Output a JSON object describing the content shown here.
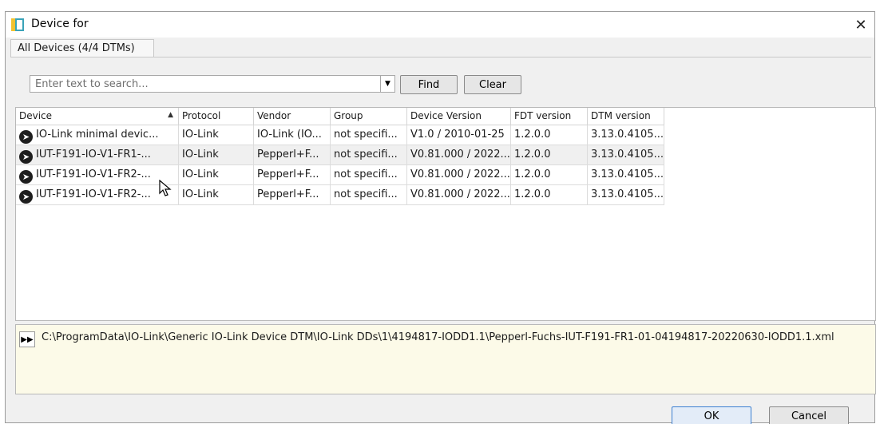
{
  "window": {
    "title": "Device for",
    "close_glyph": "✕"
  },
  "tabs": [
    {
      "label": "All Devices (4/4 DTMs)"
    }
  ],
  "search": {
    "placeholder": "Enter text to search...",
    "value": "",
    "dropdown_glyph": "▼",
    "find_label": "Find",
    "clear_label": "Clear"
  },
  "table": {
    "columns": [
      "Device",
      "Protocol",
      "Vendor",
      "Group",
      "Device Version",
      "FDT version",
      "DTM version"
    ],
    "sort_glyph": "▲",
    "rows": [
      {
        "device": "IO-Link minimal devic...",
        "protocol": "IO-Link",
        "vendor": "IO-Link (IO...",
        "group": "not specifi...",
        "device_version": "V1.0 / 2010-01-25",
        "fdt_version": "1.2.0.0",
        "dtm_version": "3.13.0.4105..."
      },
      {
        "device": "IUT-F191-IO-V1-FR1-...",
        "protocol": "IO-Link",
        "vendor": "Pepperl+F...",
        "group": "not specifi...",
        "device_version": "V0.81.000 / 2022...",
        "fdt_version": "1.2.0.0",
        "dtm_version": "3.13.0.4105..."
      },
      {
        "device": "IUT-F191-IO-V1-FR2-...",
        "protocol": "IO-Link",
        "vendor": "Pepperl+F...",
        "group": "not specifi...",
        "device_version": "V0.81.000 / 2022...",
        "fdt_version": "1.2.0.0",
        "dtm_version": "3.13.0.4105..."
      },
      {
        "device": "IUT-F191-IO-V1-FR2-...",
        "protocol": "IO-Link",
        "vendor": "Pepperl+F...",
        "group": "not specifi...",
        "device_version": "V0.81.000 / 2022...",
        "fdt_version": "1.2.0.0",
        "dtm_version": "3.13.0.4105..."
      }
    ],
    "selected_row": 1
  },
  "info": {
    "expand_glyph": "▶▶",
    "path": "C:\\ProgramData\\IO-Link\\Generic IO-Link Device DTM\\IO-Link DDs\\1\\4194817-IODD1.1\\Pepperl-Fuchs-IUT-F191-FR1-01-04194817-20220630-IODD1.1.xml"
  },
  "footer": {
    "ok_label": "OK",
    "cancel_label": "Cancel"
  },
  "icons": {
    "app": "device-for-app-icon",
    "device_row": "io-link-device-icon",
    "cursor": "mouse-pointer-icon"
  },
  "colors": {
    "info_background": "#fcfae8",
    "ok_border": "#3c7fd1",
    "app_icon_yellow": "#f2c230",
    "app_icon_teal": "#3aa3b8"
  }
}
